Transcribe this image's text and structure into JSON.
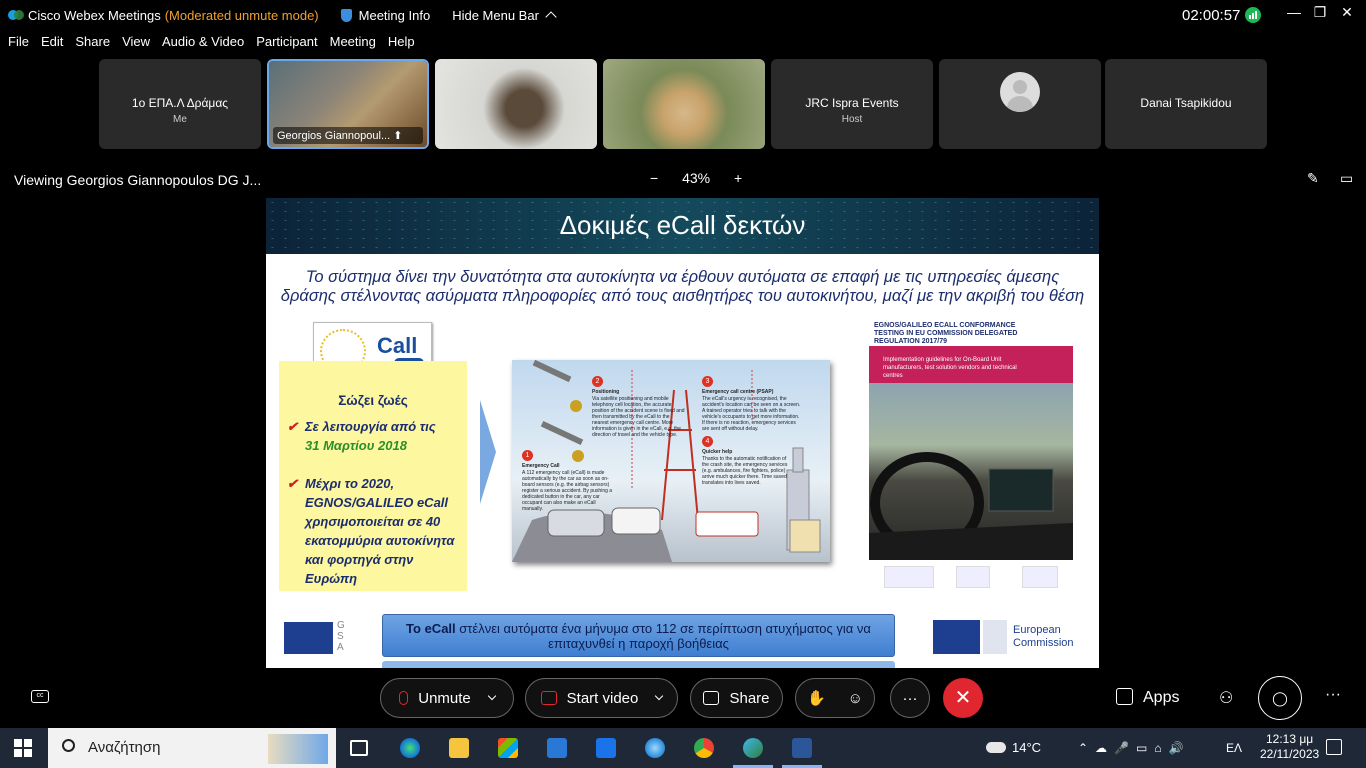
{
  "titlebar": {
    "app_name": "Cisco Webex Meetings",
    "mode": "(Moderated unmute mode)",
    "meeting_info": "Meeting Info",
    "hide_menu": "Hide Menu Bar",
    "timer": "02:00:57"
  },
  "menubar": [
    "File",
    "Edit",
    "Share",
    "View",
    "Audio & Video",
    "Participant",
    "Meeting",
    "Help"
  ],
  "participants": [
    {
      "name": "1o ΕΠΑ.Λ Δράμας",
      "sub": "Me"
    },
    {
      "name": "Georgios Giannopoul..."
    },
    {
      "name": ""
    },
    {
      "name": ""
    },
    {
      "name": "JRC Ispra Events",
      "sub": "Host"
    },
    {
      "name": ""
    },
    {
      "name": "Danai Tsapikidou"
    }
  ],
  "viewbar": {
    "viewing": "Viewing Georgios Giannopoulos DG J...",
    "zoom": "43%"
  },
  "slide": {
    "title": "Δοκιμές eCall δεκτών",
    "intro": "Το σύστημα δίνει την δυνατότητα στα αυτοκίνητα να έρθουν αυτόματα σε επαφή με τις υπηρεσίες άμεσης δράσης στέλνοντας ασύρματα πληροφορίες από τους αισθητήρες του αυτοκινήτου, μαζί με την ακριβή του θέση",
    "logo_text": "Call",
    "box_heading": "Σώζει ζωές",
    "bullet1_a": "Σε λειτουργία από τις",
    "bullet1_b": "31 Μαρτίου 2018",
    "bullet2": "Μέχρι το 2020, EGNOS/GALILEO eCall χρησιμοποιείται σε 40 εκατομμύρια αυτοκίνητα και φορτηγά στην Ευρώπη",
    "diagram": {
      "n1": "1",
      "h1": "Emergency Call",
      "t1": "A 112 emergency call (eCall) is made automatically by the car as soon as on-board sensors (e.g. the airbag sensors) register a serious accident. By pushing a dedicated button in the car, any car occupant can also make an eCall manually.",
      "n2": "2",
      "h2": "Positioning",
      "t2": "Via satellite positioning and mobile telephony cell location, the accurate position of the accident scene is fixed and then transmitted by the eCall to the nearest emergency call centre. More information is given in the eCall, e.g. the direction of travel and the vehicle type.",
      "n3": "3",
      "h3": "Emergency call centre (PSAP)",
      "t3": "The eCall's urgency is recognised, the accident's location can be seen on a screen. A trained operator tries to talk with the vehicle's occupants to get more information. If there is no reaction, emergency services are sent off without delay.",
      "n4": "4",
      "h4": "Quicker help",
      "t4": "Thanks to the automatic notification of the crash site, the emergency services (e.g. ambulances, fire fighters, police) arrive much quicker there. Time saved translates into lives saved."
    },
    "egnos_title": "EGNOS/GALILEO ECALL CONFORMANCE TESTING IN EU COMMISSION DELEGATED REGULATION 2017/79",
    "egnos_pink": "Implementation guidelines for On-Board Unit manufacturers, test solution vendors and technical centres",
    "gsa": "G\nS\nA",
    "footer_bold": "Το eCall",
    "footer_rest": " στέλνει αυτόματα ένα μήνυμα στο 112 σε περίπτωση ατυχήματος για να επιταχυνθεί η παροχή βοήθειας",
    "ec": "European\nCommission"
  },
  "controls": {
    "unmute": "Unmute",
    "start_video": "Start video",
    "share": "Share",
    "apps": "Apps",
    "more": "···",
    "end": "✕"
  },
  "taskbar": {
    "search": "Αναζήτηση",
    "temp": "14°C",
    "lang": "ΕΛ",
    "time": "12:13 μμ",
    "date": "22/11/2023"
  }
}
